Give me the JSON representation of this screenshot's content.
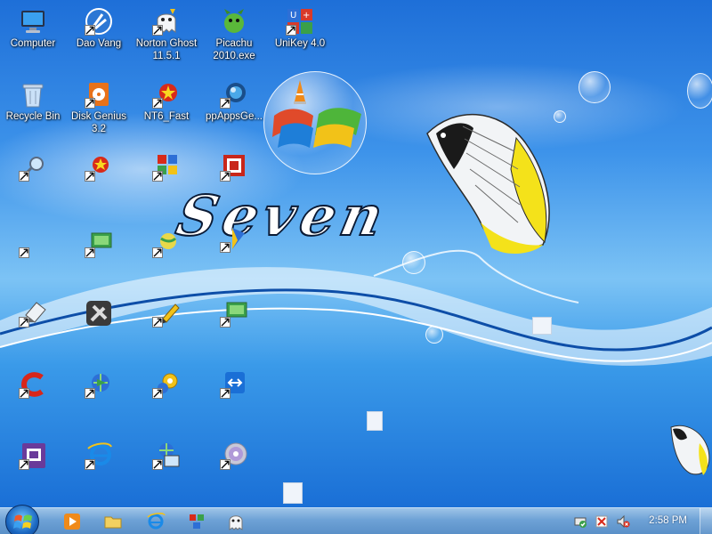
{
  "desktop": {
    "wallpaper_text": "Seven",
    "icons": [
      {
        "label": "Computer",
        "icon": "computer-icon"
      },
      {
        "label": "Dao Vang",
        "icon": "dao-vang-icon"
      },
      {
        "label": "Norton Ghost 11.5.1",
        "icon": "norton-ghost-icon"
      },
      {
        "label": "Picachu 2010.exe",
        "icon": "picachu-icon"
      },
      {
        "label": "UniKey 4.0",
        "icon": "unikey-icon"
      },
      {
        "label": "Recycle Bin",
        "icon": "recycle-bin-icon"
      },
      {
        "label": "Disk Genius 3.2",
        "icon": "disk-genius-icon"
      },
      {
        "label": "NT6_Fast",
        "icon": "nt6-fast-icon"
      },
      {
        "label": "ppAppsGe...",
        "icon": "ppappsge-icon"
      },
      {
        "label": "",
        "icon": "software-box-icon"
      },
      {
        "label": "",
        "icon": "magnifier-shortcut-icon"
      },
      {
        "label": "",
        "icon": "star-shortcut-icon"
      },
      {
        "label": "",
        "icon": "puzzle-shortcut-icon"
      },
      {
        "label": "",
        "icon": "red-grid-shortcut-icon"
      },
      {
        "label": "",
        "icon": "shortcut-icon"
      },
      {
        "label": "",
        "icon": "green-screen-shortcut-icon"
      },
      {
        "label": "",
        "icon": "ball-shortcut-icon"
      },
      {
        "label": "",
        "icon": "blue-flag-shortcut-icon"
      },
      {
        "label": "",
        "icon": "eraser-shortcut-icon"
      },
      {
        "label": "",
        "icon": "tools-shortcut-icon"
      },
      {
        "label": "",
        "icon": "pencil-shortcut-icon"
      },
      {
        "label": "",
        "icon": "green-monitor-shortcut-icon"
      },
      {
        "label": "",
        "icon": "ccleaner-shortcut-icon"
      },
      {
        "label": "",
        "icon": "globe-arrow-shortcut-icon"
      },
      {
        "label": "",
        "icon": "gear-globe-shortcut-icon"
      },
      {
        "label": "",
        "icon": "teamviewer-shortcut-icon"
      },
      {
        "label": "",
        "icon": "purple-box-shortcut-icon"
      },
      {
        "label": "",
        "icon": "internet-explorer-shortcut-icon"
      },
      {
        "label": "",
        "icon": "network-shortcut-icon"
      },
      {
        "label": "",
        "icon": "cd-shortcut-icon"
      }
    ]
  },
  "taskbar": {
    "start_icon": "windows-start-icon",
    "pinned": [
      {
        "name": "media-player",
        "icon": "media-player-icon"
      },
      {
        "name": "file-explorer",
        "icon": "folder-icon"
      },
      {
        "name": "internet-explorer",
        "icon": "internet-explorer-icon"
      },
      {
        "name": "network-tool",
        "icon": "network-tool-icon"
      },
      {
        "name": "ghost",
        "icon": "ghost-icon"
      }
    ],
    "tray": [
      {
        "name": "action-center",
        "icon": "action-center-icon"
      },
      {
        "name": "unikey-tray",
        "icon": "unikey-tray-icon"
      },
      {
        "name": "volume-muted",
        "icon": "volume-muted-icon"
      }
    ],
    "clock": "2:58 PM"
  },
  "colors": {
    "wallpaper_top": "#1e6fd8",
    "wallpaper_mid": "#7cc3f5",
    "taskbar": "#6ea2d6",
    "fish_yellow": "#f4e21a"
  }
}
